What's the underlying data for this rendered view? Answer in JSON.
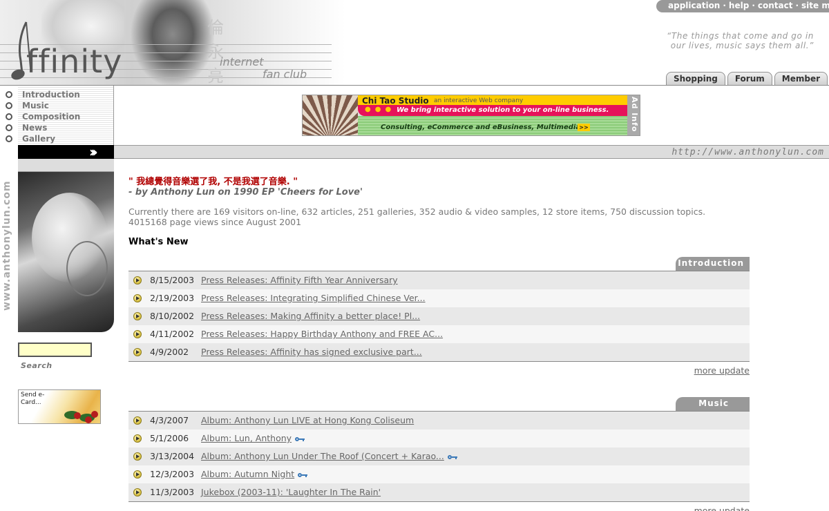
{
  "header": {
    "logo_text": "ffinity",
    "fan_club_line1": "internet",
    "fan_club_line2": "fan club",
    "top_links": [
      "application",
      "help",
      "contact",
      "site map"
    ],
    "quote_line1": "“The things that come and go in",
    "quote_line2": "our lives, music says them all.”",
    "tabs": [
      "Shopping",
      "Forum",
      "Member"
    ]
  },
  "nav": {
    "items": [
      "Introduction",
      "Music",
      "Composition",
      "News",
      "Gallery"
    ]
  },
  "ad": {
    "title": "Chi Tao Studio",
    "subtitle": "an interactive Web company",
    "tagline": "We bring interactive solution to your on-line business.",
    "services": "Consulting, eCommerce and eBusiness, Multimedia...",
    "go": ">>",
    "info": "Ad Info"
  },
  "urlbar": {
    "arrows": "›››",
    "url": "http://www.anthonylun.com"
  },
  "sidebar": {
    "vertical_text": "www.anthonylun.com",
    "search_label": "Search",
    "ecard_label": "Send e-Card..."
  },
  "main": {
    "quote_cn": "\" 我總覺得音樂選了我, 不是我選了音樂. \"",
    "quote_by": "- by Anthony Lun on 1990 EP 'Cheers for Love'",
    "stats": "Currently there are 169 visitors on-line, 632 articles, 251 galleries, 352 audio & video samples, 12 store items, 750 discussion topics. 4015168 page views since August 2001",
    "whats_new": "What's New",
    "sections": [
      {
        "tab": "Introduction",
        "rows": [
          {
            "date": "8/15/2003",
            "title": "Press Releases: Affinity Fifth Year Anniversary",
            "key": false
          },
          {
            "date": "2/19/2003",
            "title": "Press Releases: Integrating Simplified Chinese Ver...",
            "key": false
          },
          {
            "date": "8/10/2002",
            "title": "Press Releases: Making Affinity a better place! Pl...",
            "key": false
          },
          {
            "date": "4/11/2002",
            "title": "Press Releases: Happy Birthday Anthony and FREE AC...",
            "key": false
          },
          {
            "date": "4/9/2002",
            "title": "Press Releases: Affinity has signed exclusive part...",
            "key": false
          }
        ],
        "more": "more update"
      },
      {
        "tab": "Music",
        "rows": [
          {
            "date": "4/3/2007",
            "title": "Album: Anthony Lun LIVE at Hong Kong Coliseum",
            "key": false
          },
          {
            "date": "5/1/2006",
            "title": "Album: Lun, Anthony",
            "key": true
          },
          {
            "date": "3/13/2004",
            "title": "Album: Anthony Lun Under The Roof (Concert + Karao...",
            "key": true
          },
          {
            "date": "12/3/2003",
            "title": "Album: Autumn Night",
            "key": true
          },
          {
            "date": "11/3/2003",
            "title": "Jukebox (2003-11): 'Laughter In The Rain'",
            "key": false
          }
        ],
        "more": "more update"
      }
    ]
  }
}
